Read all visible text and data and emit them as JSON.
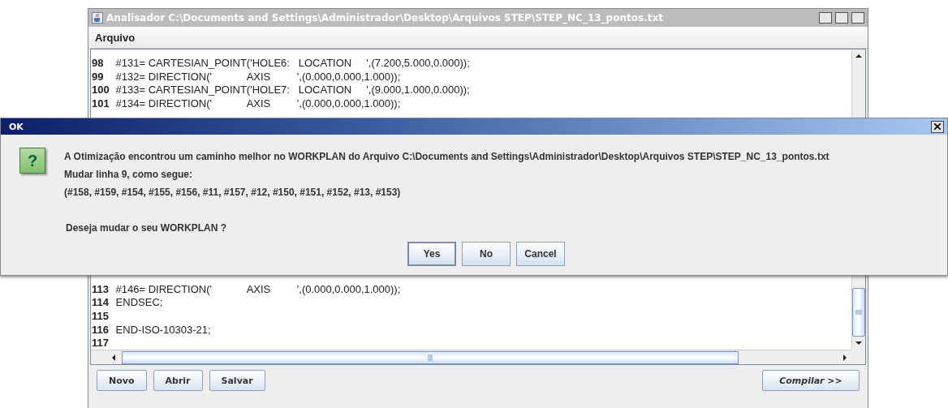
{
  "window": {
    "title": "Analisador C:\\Documents and Settings\\Administrador\\Desktop\\Arquivos STEP\\STEP_NC_13_pontos.txt"
  },
  "menu": [
    "Arquivo"
  ],
  "editor": {
    "lines_above": [
      {
        "number": "98",
        "text": "#131= CARTESIAN_POINT('HOLE6:   LOCATION     ',(7.200,5.000,0.000));"
      },
      {
        "number": "99",
        "text": "#132= DIRECTION('            AXIS         ',(0.000,0.000,1.000));"
      },
      {
        "number": "100",
        "text": "#133= CARTESIAN_POINT('HOLE7:   LOCATION     ',(9.000,1.000,0.000));"
      },
      {
        "number": "101",
        "text": "#134= DIRECTION('            AXIS         ',(0.000,0.000,1.000));"
      }
    ],
    "lines_below": [
      {
        "number": "113",
        "text": "#146= DIRECTION('            AXIS         ',(0.000,0.000,1.000));"
      },
      {
        "number": "114",
        "text": "ENDSEC;"
      },
      {
        "number": "115"
      },
      {
        "number": "116",
        "text": "END-ISO-10303-21;"
      },
      {
        "number": "117"
      }
    ]
  },
  "buttons": [
    "Novo",
    "Abrir",
    "Salvar"
  ],
  "compile_button": "Compilar >>",
  "dialog": {
    "title": "OK",
    "icon_glyph": "?",
    "message": [
      "A Otimização encontrou um caminho melhor no WORKPLAN do Arquivo C:\\Documents and Settings\\Administrador\\Desktop\\Arquivos STEP\\STEP_NC_13_pontos.txt",
      "Mudar linha 9, como segue:",
      "(#158, #159, #154, #155, #156, #11, #157, #12, #150, #151, #152, #13, #153)"
    ],
    "question": "Deseja mudar o seu WORKPLAN ?",
    "buttons": [
      {
        "label": "Yes",
        "selected": true
      },
      {
        "label": "No",
        "selected": false
      },
      {
        "label": "Cancel",
        "selected": false
      }
    ]
  }
}
